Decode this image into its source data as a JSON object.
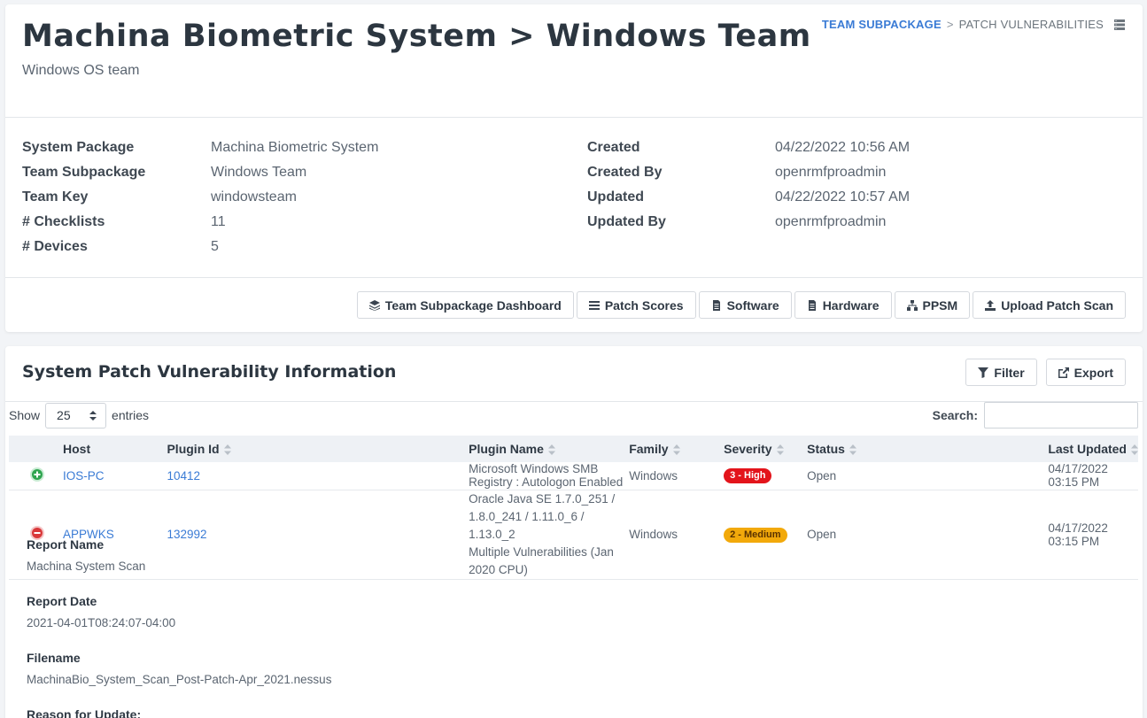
{
  "header": {
    "title": "Machina Biometric System > Windows Team",
    "subtitle": "Windows OS team",
    "breadcrumb": {
      "link": "TEAM SUBPACKAGE",
      "separator": ">",
      "current": "PATCH VULNERABILITIES"
    }
  },
  "info_left": [
    {
      "label": "System Package",
      "value": "Machina Biometric System"
    },
    {
      "label": "Team Subpackage",
      "value": "Windows Team"
    },
    {
      "label": "Team Key",
      "value": "windowsteam"
    },
    {
      "label": "# Checklists",
      "value": "11"
    },
    {
      "label": "# Devices",
      "value": "5"
    }
  ],
  "info_right": [
    {
      "label": "Created",
      "value": "04/22/2022 10:56 AM"
    },
    {
      "label": "Created By",
      "value": "openrmfproadmin"
    },
    {
      "label": "Updated",
      "value": "04/22/2022 10:57 AM"
    },
    {
      "label": "Updated By",
      "value": "openrmfproadmin"
    }
  ],
  "actions": [
    {
      "label": "Team Subpackage Dashboard",
      "icon": "layers-icon"
    },
    {
      "label": "Patch Scores",
      "icon": "list-icon"
    },
    {
      "label": "Software",
      "icon": "file-icon"
    },
    {
      "label": "Hardware",
      "icon": "file-icon"
    },
    {
      "label": "PPSM",
      "icon": "network-icon"
    },
    {
      "label": "Upload Patch Scan",
      "icon": "upload-icon"
    }
  ],
  "section": {
    "title": "System Patch Vulnerability Information",
    "filter_label": "Filter",
    "export_label": "Export"
  },
  "table_controls": {
    "show_label": "Show",
    "entries_value": "25",
    "entries_label": "entries",
    "search_label": "Search:",
    "search_value": ""
  },
  "table": {
    "columns": [
      "Host",
      "Plugin Id",
      "Plugin Name",
      "Family",
      "Severity",
      "Status",
      "Last Updated"
    ],
    "rows": [
      {
        "expanded": false,
        "host": "IOS-PC",
        "plugin_id": "10412",
        "plugin_name": "Microsoft Windows SMB Registry : Autologon Enabled",
        "family": "Windows",
        "severity": "3 - High",
        "status": "Open",
        "last_updated": "04/17/2022 03:15 PM"
      },
      {
        "expanded": true,
        "host": "APPWKS",
        "plugin_id": "132992",
        "plugin_name_line1": "Oracle Java SE 1.7.0_251 / 1.8.0_241 / 1.11.0_6 / 1.13.0_2",
        "plugin_name_line2": "Multiple Vulnerabilities (Jan 2020 CPU)",
        "family": "Windows",
        "severity": "2 - Medium",
        "status": "Open",
        "last_updated": "04/17/2022 03:15 PM"
      }
    ]
  },
  "detail": {
    "report_name_label": "Report Name",
    "report_name": "Machina System Scan",
    "report_date_label": "Report Date",
    "report_date": "2021-04-01T08:24:07-04:00",
    "filename_label": "Filename",
    "filename": "MachinaBio_System_Scan_Post-Patch-Apr_2021.nessus",
    "reason_label": "Reason for Update:"
  },
  "colors": {
    "link": "#3a7bd5",
    "severity_high": "#e3141b",
    "severity_medium": "#f2a90b",
    "expand_green": "#2ea44f",
    "collapse_red": "#d9383a"
  }
}
